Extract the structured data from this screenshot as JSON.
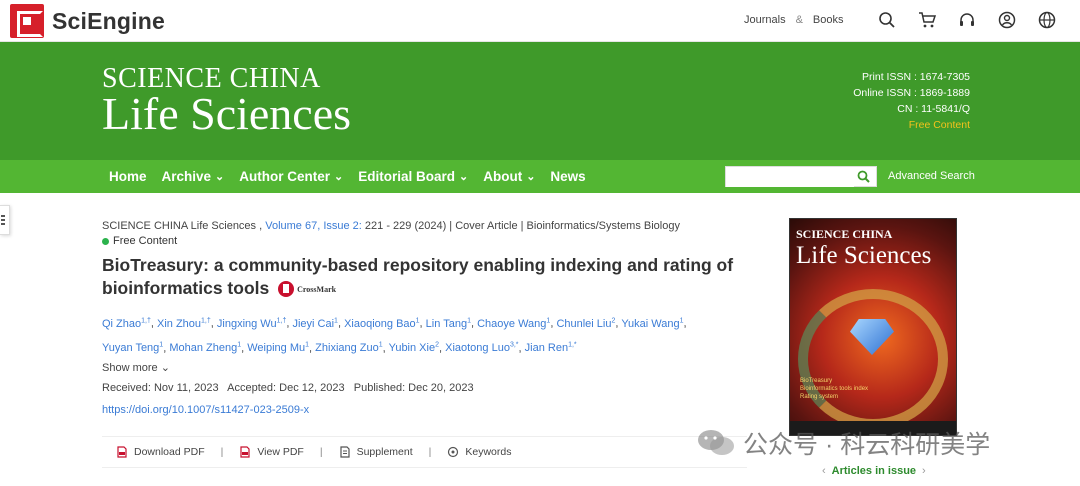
{
  "header": {
    "brand": "SciEngine",
    "links": [
      "Journals",
      "&",
      "Books"
    ],
    "icons": [
      "search-icon",
      "cart-icon",
      "headset-icon",
      "user-icon",
      "language-icon"
    ]
  },
  "banner": {
    "title_line1": "SCIENCE CHINA",
    "title_line2": "Life Sciences",
    "print_issn": "Print ISSN : 1674-7305",
    "online_issn": "Online ISSN : 1869-1889",
    "cn": "CN : 11-5841/Q",
    "free_content": "Free Content"
  },
  "nav": {
    "items": [
      {
        "label": "Home",
        "dropdown": false
      },
      {
        "label": "Archive",
        "dropdown": true
      },
      {
        "label": "Author Center",
        "dropdown": true
      },
      {
        "label": "Editorial Board",
        "dropdown": true
      },
      {
        "label": "About",
        "dropdown": true
      },
      {
        "label": "News",
        "dropdown": false
      }
    ],
    "search_placeholder": "",
    "advanced_search": "Advanced Search"
  },
  "article": {
    "journal": "SCIENCE CHINA Life Sciences ,",
    "volume": "Volume 67, Issue 2:",
    "pages_rest": " 221 - 229 (2024) | Cover Article | Bioinformatics/Systems Biology",
    "free_content": "Free Content",
    "title": "BioTreasury: a community-based repository enabling indexing and rating of bioinformatics tools",
    "crossmark": "CrossMark",
    "authors": [
      {
        "name": "Qi Zhao",
        "aff": "1,†"
      },
      {
        "name": "Xin Zhou",
        "aff": "1,†"
      },
      {
        "name": "Jingxing Wu",
        "aff": "1,†"
      },
      {
        "name": "Jieyi Cai",
        "aff": "1"
      },
      {
        "name": "Xiaoqiong Bao",
        "aff": "1"
      },
      {
        "name": "Lin Tang",
        "aff": "1"
      },
      {
        "name": "Chaoye Wang",
        "aff": "1"
      },
      {
        "name": "Chunlei Liu",
        "aff": "2"
      },
      {
        "name": "Yukai Wang",
        "aff": "1"
      },
      {
        "name": "Yuyan Teng",
        "aff": "1"
      },
      {
        "name": "Mohan Zheng",
        "aff": "1"
      },
      {
        "name": "Weiping Mu",
        "aff": "1"
      },
      {
        "name": "Zhixiang Zuo",
        "aff": "1"
      },
      {
        "name": "Yubin Xie",
        "aff": "2"
      },
      {
        "name": "Xiaotong Luo",
        "aff": "3,*"
      },
      {
        "name": "Jian Ren",
        "aff": "1,*"
      }
    ],
    "show_more": "Show more",
    "received": "Received: Nov 11, 2023",
    "accepted": "Accepted: Dec 12, 2023",
    "published": "Published: Dec 20, 2023",
    "doi": "https://doi.org/10.1007/s11427-023-2509-x",
    "actions": [
      "Download PDF",
      "View PDF",
      "Supplement",
      "Keywords"
    ]
  },
  "cover": {
    "head1": "SCIENCE CHINA",
    "head2": "Life Sciences",
    "notes": [
      "BioTreasury",
      "Bioinformatics tools index",
      "Rating system"
    ]
  },
  "articles_in_issue": "Articles in issue",
  "watermark": "公众号 · 科云科研美学"
}
